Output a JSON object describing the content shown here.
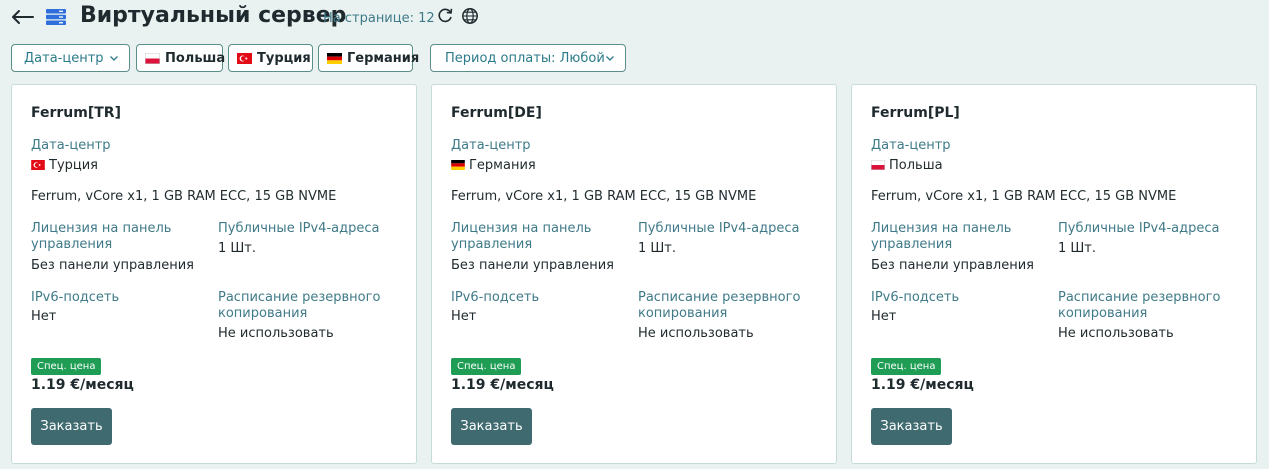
{
  "header": {
    "title": "Виртуальный сервер",
    "per_page": "На странице: 12"
  },
  "filters": {
    "datacenter_label": "Дата-центр",
    "flags": [
      {
        "label": "Польша",
        "country": "pl"
      },
      {
        "label": "Турция",
        "country": "tr"
      },
      {
        "label": "Германия",
        "country": "de"
      }
    ],
    "billing_label": "Период оплаты: Любой"
  },
  "cards": [
    {
      "name": "Ferrum[TR]",
      "datacenter_label": "Дата-центр",
      "datacenter_value": "Турция",
      "country": "tr",
      "specs": "Ferrum, vCore x1, 1 GB RAM ECC, 15 GB NVME",
      "license_label_line1": "Лицензия на панель",
      "license_label_line2": "управления",
      "license_value": "Без панели управления",
      "ipv4_label": "Публичные IPv4-адреса",
      "ipv4_value": "1 Шт.",
      "ipv6_label": "IPv6-подсеть",
      "ipv6_value": "Нет",
      "backup_label_line1": "Расписание резервного",
      "backup_label_line2": "копирования",
      "backup_value": "Не использовать",
      "badge": "Спец. цена",
      "price": "1.19 €/месяц",
      "order": "Заказать"
    },
    {
      "name": "Ferrum[DE]",
      "datacenter_label": "Дата-центр",
      "datacenter_value": "Германия",
      "country": "de",
      "specs": "Ferrum, vCore x1, 1 GB RAM ECC, 15 GB NVME",
      "license_label_line1": "Лицензия на панель",
      "license_label_line2": "управления",
      "license_value": "Без панели управления",
      "ipv4_label": "Публичные IPv4-адреса",
      "ipv4_value": "1 Шт.",
      "ipv6_label": "IPv6-подсеть",
      "ipv6_value": "Нет",
      "backup_label_line1": "Расписание резервного",
      "backup_label_line2": "копирования",
      "backup_value": "Не использовать",
      "badge": "Спец. цена",
      "price": "1.19 €/месяц",
      "order": "Заказать"
    },
    {
      "name": "Ferrum[PL]",
      "datacenter_label": "Дата-центр",
      "datacenter_value": "Польша",
      "country": "pl",
      "specs": "Ferrum, vCore x1, 1 GB RAM ECC, 15 GB NVME",
      "license_label_line1": "Лицензия на панель",
      "license_label_line2": "управления",
      "license_value": "Без панели управления",
      "ipv4_label": "Публичные IPv4-адреса",
      "ipv4_value": "1 Шт.",
      "ipv6_label": "IPv6-подсеть",
      "ipv6_value": "Нет",
      "backup_label_line1": "Расписание резервного",
      "backup_label_line2": "копирования",
      "backup_value": "Не использовать",
      "badge": "Спец. цена",
      "price": "1.19 €/месяц",
      "order": "Заказать"
    }
  ],
  "icons": {
    "back": "arrow-left-icon",
    "server": "server-icon",
    "refresh": "refresh-icon",
    "globe": "globe-icon",
    "chevron": "chevron-down-icon"
  },
  "colors": {
    "background": "#e9f2f1",
    "accent": "#3f7a88",
    "badge": "#1f9d55",
    "button": "#3f6a70",
    "server_icon": "#2f6fdb"
  }
}
